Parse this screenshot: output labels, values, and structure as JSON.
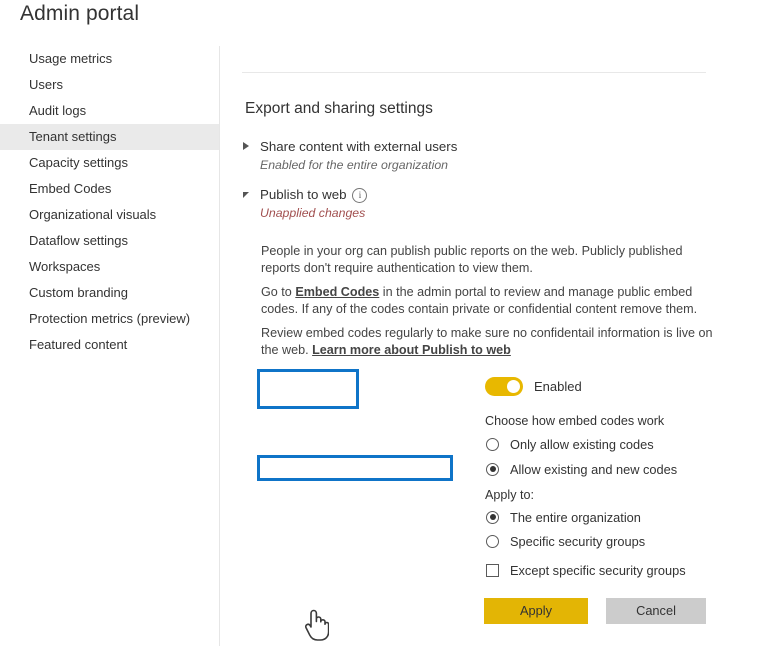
{
  "page": {
    "title": "Admin portal"
  },
  "sidebar": {
    "items": [
      {
        "label": "Usage metrics",
        "selected": false
      },
      {
        "label": "Users",
        "selected": false
      },
      {
        "label": "Audit logs",
        "selected": false
      },
      {
        "label": "Tenant settings",
        "selected": true
      },
      {
        "label": "Capacity settings",
        "selected": false
      },
      {
        "label": "Embed Codes",
        "selected": false
      },
      {
        "label": "Organizational visuals",
        "selected": false
      },
      {
        "label": "Dataflow settings",
        "selected": false
      },
      {
        "label": "Workspaces",
        "selected": false
      },
      {
        "label": "Custom branding",
        "selected": false
      },
      {
        "label": "Protection metrics (preview)",
        "selected": false
      },
      {
        "label": "Featured content",
        "selected": false
      }
    ]
  },
  "main": {
    "section_heading": "Export and sharing settings",
    "groups": [
      {
        "title": "Share content with external users",
        "status": "Enabled for the entire organization",
        "expanded": false
      },
      {
        "title": "Publish to web",
        "status": "Unapplied changes",
        "expanded": true,
        "info_icon": "info-circle-icon"
      }
    ],
    "paragraphs": [
      {
        "parts": [
          {
            "text": "People in your org can publish public reports on the web. Publicly published reports don't require authentication to view them.",
            "link": false
          }
        ]
      },
      {
        "parts": [
          {
            "text": "Go to ",
            "link": false
          },
          {
            "text": "Embed Codes",
            "link": true
          },
          {
            "text": " in the admin portal to review and manage public embed codes. If any of the codes contain private or confidential content remove them.",
            "link": false
          }
        ]
      },
      {
        "parts": [
          {
            "text": "Review embed codes regularly to make sure no confidentail information is live on the web. ",
            "link": false
          },
          {
            "text": "Learn more about Publish to web",
            "link": true
          }
        ]
      }
    ],
    "toggle": {
      "label": "Enabled",
      "state": "on",
      "color": "#e8b800"
    },
    "embed_codes_group": {
      "heading": "Choose how embed codes work",
      "options": [
        {
          "label": "Only allow existing codes",
          "selected": false
        },
        {
          "label": "Allow existing and new codes",
          "selected": true
        }
      ]
    },
    "apply_to_group": {
      "heading": "Apply to:",
      "options": [
        {
          "label": "The entire organization",
          "selected": true
        },
        {
          "label": "Specific security groups",
          "selected": false
        }
      ],
      "checkbox": {
        "label": "Except specific security groups",
        "checked": false
      }
    },
    "buttons": {
      "apply": "Apply",
      "cancel": "Cancel"
    }
  },
  "annotations": {
    "highlight_color": "#0f74c8",
    "boxes": [
      {
        "target": "publish-to-web-toggle"
      },
      {
        "target": "allow-existing-and-new-codes-option"
      }
    ]
  },
  "cursor": {
    "type": "hand-pointer-cursor"
  }
}
